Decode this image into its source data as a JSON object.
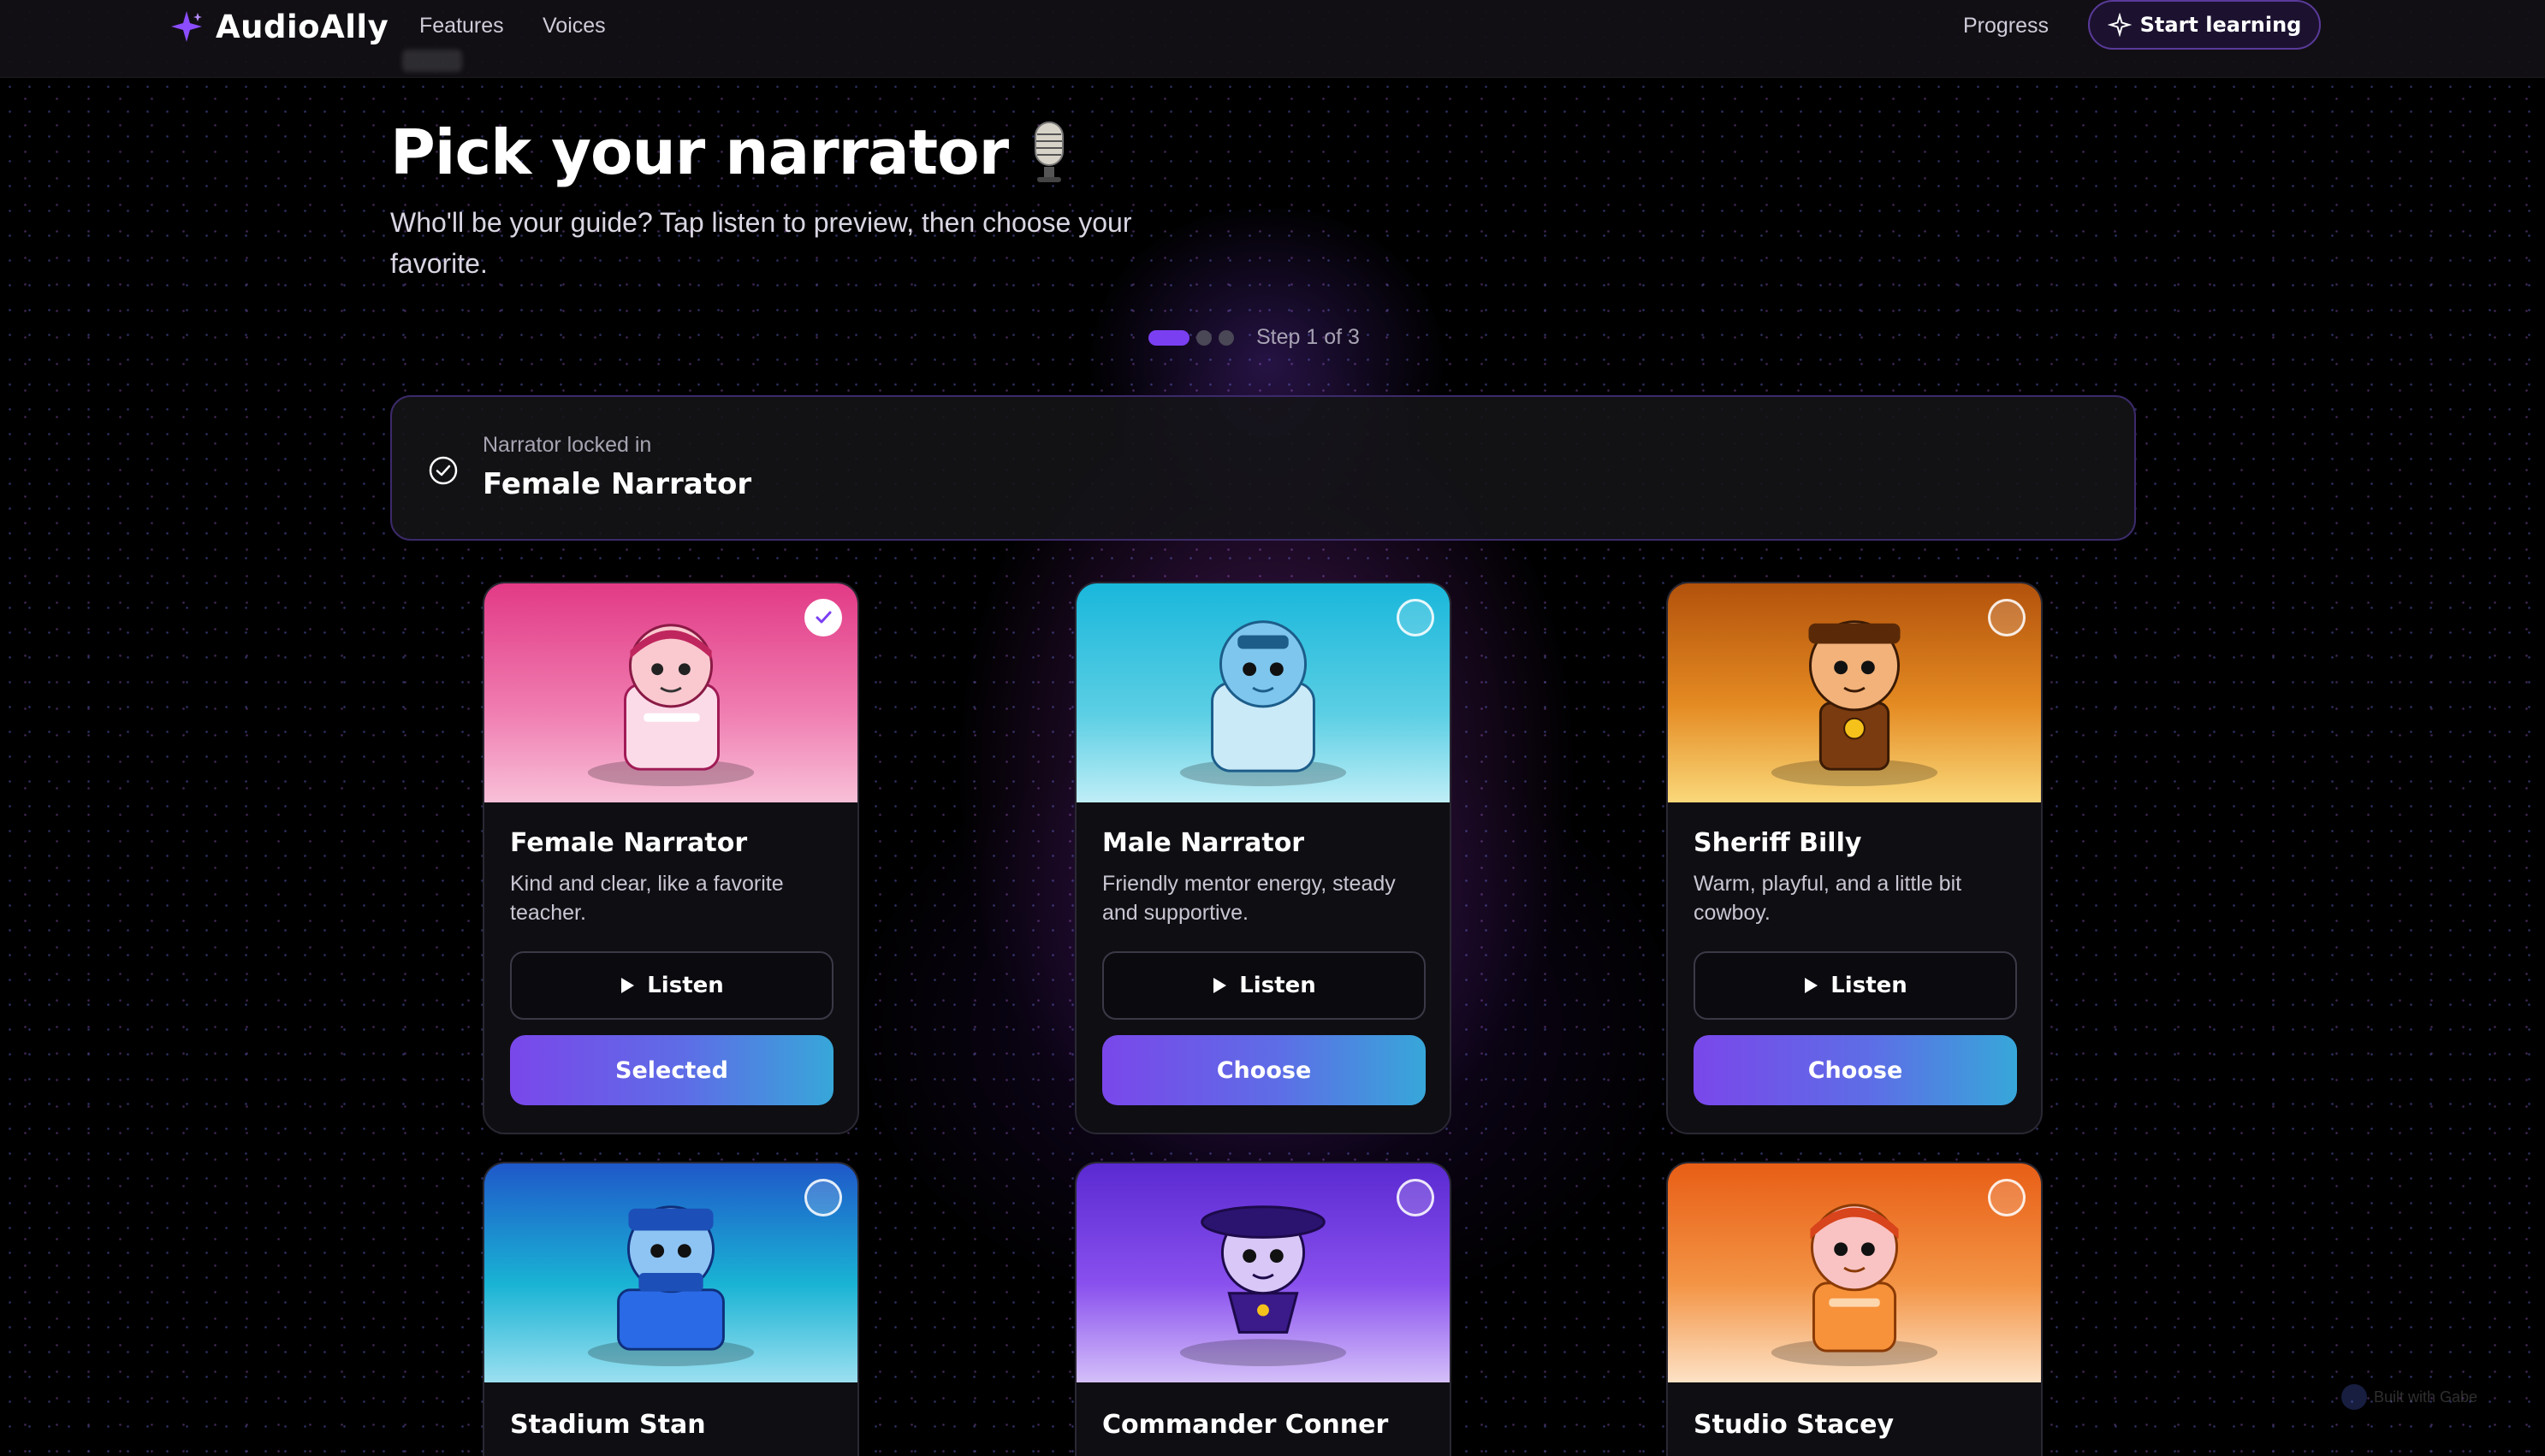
{
  "header": {
    "brand": "AudioAlly",
    "nav": [
      {
        "label": "Features"
      },
      {
        "label": "Voices"
      }
    ],
    "progress_label": "Progress",
    "cta_label": "Start learning"
  },
  "page": {
    "title": "Pick your narrator",
    "subtitle": "Who'll be your guide? Tap listen to preview, then choose your favorite.",
    "step_text": "Step 1 of 3",
    "step_current": 1,
    "step_total": 3
  },
  "banner": {
    "label": "Narrator locked in",
    "value": "Female Narrator"
  },
  "narrators": [
    {
      "name": "Female Narrator",
      "desc": "Kind and clear, like a favorite teacher.",
      "listen": "Listen",
      "action": "Selected",
      "selected": true,
      "accent": "#e7458f"
    },
    {
      "name": "Male Narrator",
      "desc": "Friendly mentor energy, steady and supportive.",
      "listen": "Listen",
      "action": "Choose",
      "selected": false,
      "accent": "#1fb6d9"
    },
    {
      "name": "Sheriff Billy",
      "desc": "Warm, playful, and a little bit cowboy.",
      "listen": "Listen",
      "action": "Choose",
      "selected": false,
      "accent": "#d9821a"
    },
    {
      "name": "Stadium Stan",
      "desc": "",
      "listen": "",
      "action": "",
      "selected": false,
      "accent": "#1f6bd9"
    },
    {
      "name": "Commander Conner",
      "desc": "",
      "listen": "",
      "action": "",
      "selected": false,
      "accent": "#6a35e6"
    },
    {
      "name": "Studio Stacey",
      "desc": "",
      "listen": "",
      "action": "",
      "selected": false,
      "accent": "#f06d1a"
    }
  ],
  "watermark": "Built with Gabe"
}
